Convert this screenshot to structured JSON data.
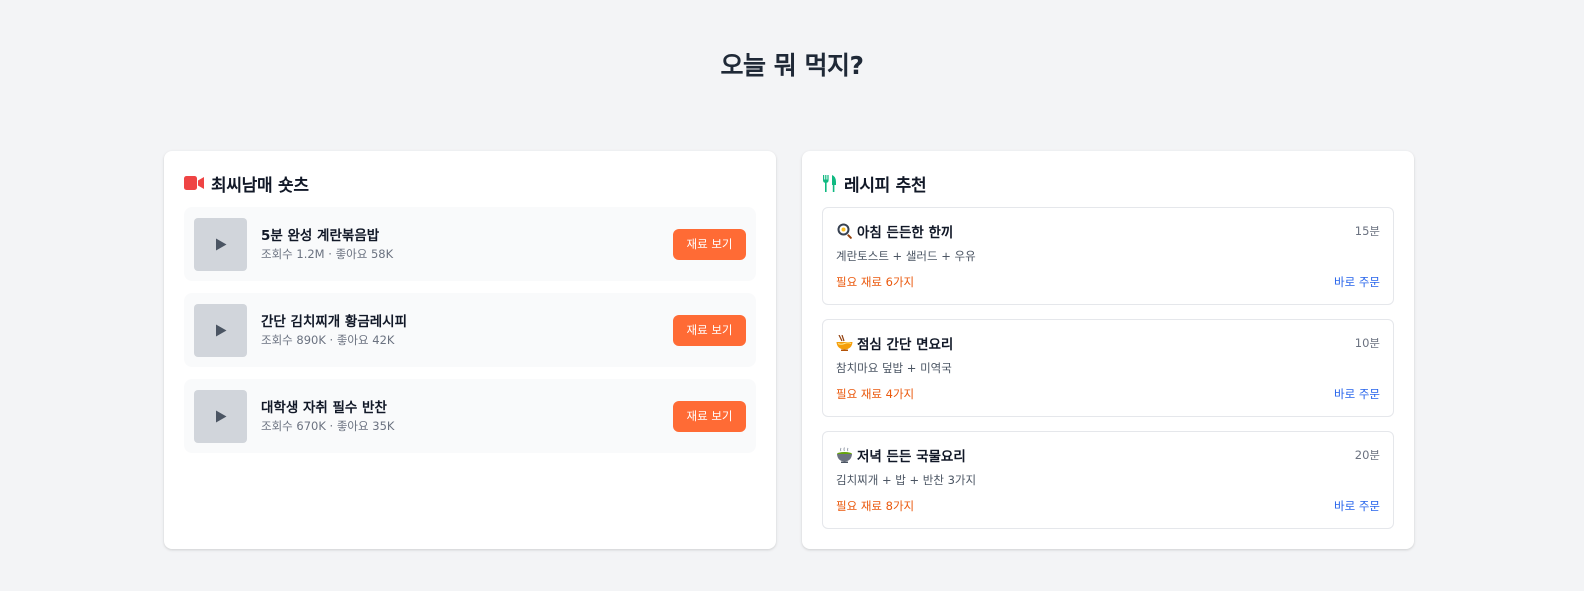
{
  "page": {
    "title": "오늘 뭐 먹지?"
  },
  "colors": {
    "accent": "#ff6b35",
    "video_icon": "#ef4444",
    "fork_icon": "#10b981",
    "need_text": "#ea580c",
    "order_text": "#2563eb"
  },
  "shorts": {
    "title": "최씨남매 숏츠",
    "icon": "video-camera-icon",
    "items": [
      {
        "title": "5분 완성 계란볶음밥",
        "meta": "조회수 1.2M · 좋아요 58K",
        "button": "재료 보기"
      },
      {
        "title": "간단 김치찌개 황금레시피",
        "meta": "조회수 890K · 좋아요 42K",
        "button": "재료 보기"
      },
      {
        "title": "대학생 자취 필수 반찬",
        "meta": "조회수 670K · 좋아요 35K",
        "button": "재료 보기"
      }
    ]
  },
  "recipes": {
    "title": "레시피 추천",
    "icon": "fork-knife-icon",
    "items": [
      {
        "icon": "frying-pan-icon",
        "name": "아침 든든한 한끼",
        "time": "15분",
        "combo": "계란토스트 + 샐러드 + 우유",
        "need": "필요 재료 6가지",
        "order": "바로 주문"
      },
      {
        "icon": "noodle-bowl-icon",
        "name": "점심 간단 면요리",
        "time": "10분",
        "combo": "참치마요 덮밥 + 미역국",
        "need": "필요 재료 4가지",
        "order": "바로 주문"
      },
      {
        "icon": "stew-pot-icon",
        "name": "저녁 든든 국물요리",
        "time": "20분",
        "combo": "김치찌개 + 밥 + 반찬 3가지",
        "need": "필요 재료 8가지",
        "order": "바로 주문"
      }
    ]
  }
}
